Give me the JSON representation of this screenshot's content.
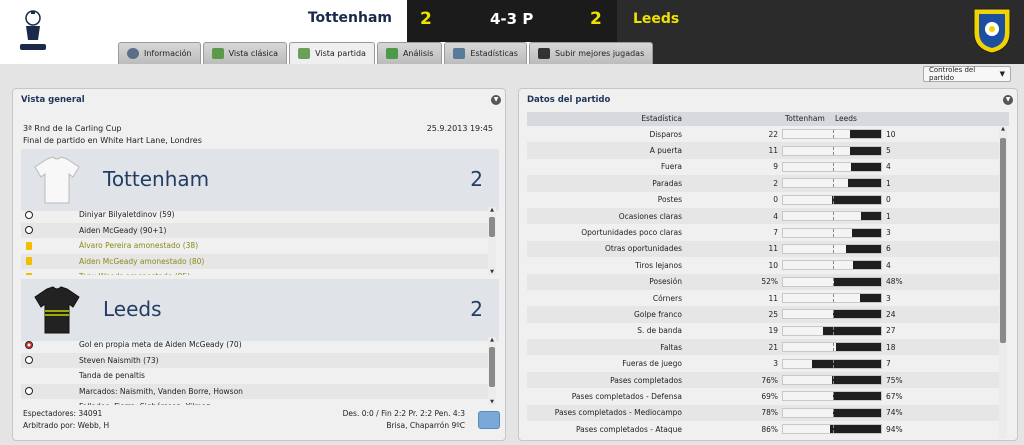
{
  "header": {
    "home_team": "Tottenham",
    "home_score": "2",
    "result": "4-3 P",
    "away_score": "2",
    "away_team": "Leeds"
  },
  "tabs": [
    "Información",
    "Vista clásica",
    "Vista partida",
    "Análisis",
    "Estadísticas",
    "Subir mejores jugadas"
  ],
  "controls_label": "Controles del partido",
  "overview": {
    "title": "Vista general",
    "competition": "3ª Rnd de la Carling Cup",
    "datetime": "25.9.2013 19:45",
    "venue": "Final de partido en White Hart Lane, Londres",
    "home": {
      "name": "Tottenham",
      "score": "2",
      "events": [
        {
          "icon": "ball",
          "text": "Diniyar Bilyaletdinov (59)"
        },
        {
          "icon": "ball",
          "text": "Aiden McGeady (90+1)"
        },
        {
          "icon": "yellow",
          "text": "Álvaro Pereira amonestado (38)"
        },
        {
          "icon": "yellow",
          "text": "Aiden McGeady amonestado (80)"
        },
        {
          "icon": "yellow",
          "text": "Tony Woods amonestado (85)"
        }
      ]
    },
    "away": {
      "name": "Leeds",
      "score": "2",
      "events": [
        {
          "icon": "own",
          "text": "Gol en propia meta de Aiden McGeady (70)"
        },
        {
          "icon": "ball",
          "text": "Steven Naismith (73)"
        },
        {
          "icon": "none",
          "text": "Tanda de penaltis"
        },
        {
          "icon": "ball",
          "text": "Marcados: Naismith, Vanden Borre, Howson"
        },
        {
          "icon": "none",
          "text": "Fallados: Fierro, Sigþórsson, Yilmaz"
        }
      ]
    },
    "attendance": "Espectadores: 34091",
    "referee": "Arbitrado por: Webb, H",
    "periods": "Des. 0:0 / Fin 2:2 Pr. 2:2 Pen. 4:3",
    "weather": "Brisa, Chaparrón 9ºC"
  },
  "stats": {
    "title": "Datos del partido",
    "col_stat": "Estadística",
    "col_home": "Tottenham",
    "col_away": "Leeds",
    "rows": [
      {
        "label": "Disparos",
        "home": "22",
        "away": "10",
        "hf": 0.6875
      },
      {
        "label": "A puerta",
        "home": "11",
        "away": "5",
        "hf": 0.6875
      },
      {
        "label": "Fuera",
        "home": "9",
        "away": "4",
        "hf": 0.6923
      },
      {
        "label": "Paradas",
        "home": "2",
        "away": "1",
        "hf": 0.6667
      },
      {
        "label": "Postes",
        "home": "0",
        "away": "0",
        "hf": 0.5
      },
      {
        "label": "Ocasiones claras",
        "home": "4",
        "away": "1",
        "hf": 0.8
      },
      {
        "label": "Oportunidades poco claras",
        "home": "7",
        "away": "3",
        "hf": 0.7
      },
      {
        "label": "Otras oportunidades",
        "home": "11",
        "away": "6",
        "hf": 0.647
      },
      {
        "label": "Tiros lejanos",
        "home": "10",
        "away": "4",
        "hf": 0.714
      },
      {
        "label": "Posesión",
        "home": "52%",
        "away": "48%",
        "hf": 0.52
      },
      {
        "label": "Córners",
        "home": "11",
        "away": "3",
        "hf": 0.786
      },
      {
        "label": "Golpe franco",
        "home": "25",
        "away": "24",
        "hf": 0.51
      },
      {
        "label": "S. de banda",
        "home": "19",
        "away": "27",
        "hf": 0.413
      },
      {
        "label": "Faltas",
        "home": "21",
        "away": "18",
        "hf": 0.538
      },
      {
        "label": "Fueras de juego",
        "home": "3",
        "away": "7",
        "hf": 0.3
      },
      {
        "label": "Pases completados",
        "home": "76%",
        "away": "75%",
        "hf": 0.503
      },
      {
        "label": "Pases completados - Defensa",
        "home": "69%",
        "away": "67%",
        "hf": 0.507
      },
      {
        "label": "Pases completados - Mediocampo",
        "home": "78%",
        "away": "74%",
        "hf": 0.513
      },
      {
        "label": "Pases completados - Ataque",
        "home": "86%",
        "away": "94%",
        "hf": 0.478
      }
    ]
  }
}
